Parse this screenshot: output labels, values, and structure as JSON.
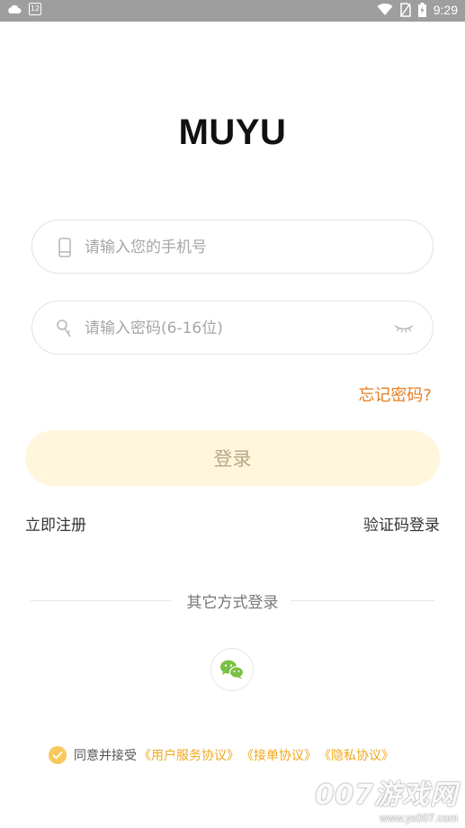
{
  "status_bar": {
    "calendar_day": "12",
    "time": "9:29",
    "icons": [
      "cloud-icon",
      "calendar-icon",
      "wifi-icon",
      "no-sim-icon",
      "battery-icon"
    ]
  },
  "app": {
    "logo": "MUYU"
  },
  "form": {
    "phone_placeholder": "请输入您的手机号",
    "password_placeholder": "请输入密码(6-16位)",
    "forgot_label": "忘记密码?",
    "login_label": "登录"
  },
  "links": {
    "register": "立即注册",
    "code_login": "验证码登录"
  },
  "other_login": {
    "label": "其它方式登录",
    "wechat_icon": "wechat-icon"
  },
  "agreement": {
    "prefix": "同意并接受",
    "user_service": "《用户服务协议》",
    "order": "《接单协议》",
    "privacy": "《隐私协议》",
    "checked": true
  },
  "watermark": {
    "brand": "007游戏网",
    "url": "www.yx007.com"
  },
  "colors": {
    "status_bar": "#9e9e9e",
    "accent_orange": "#e67e22",
    "login_button_bg": "#fff6dc",
    "agreement_link": "#f0a81e",
    "checkbox": "#f7c85c",
    "wechat_green": "#7bc043"
  }
}
